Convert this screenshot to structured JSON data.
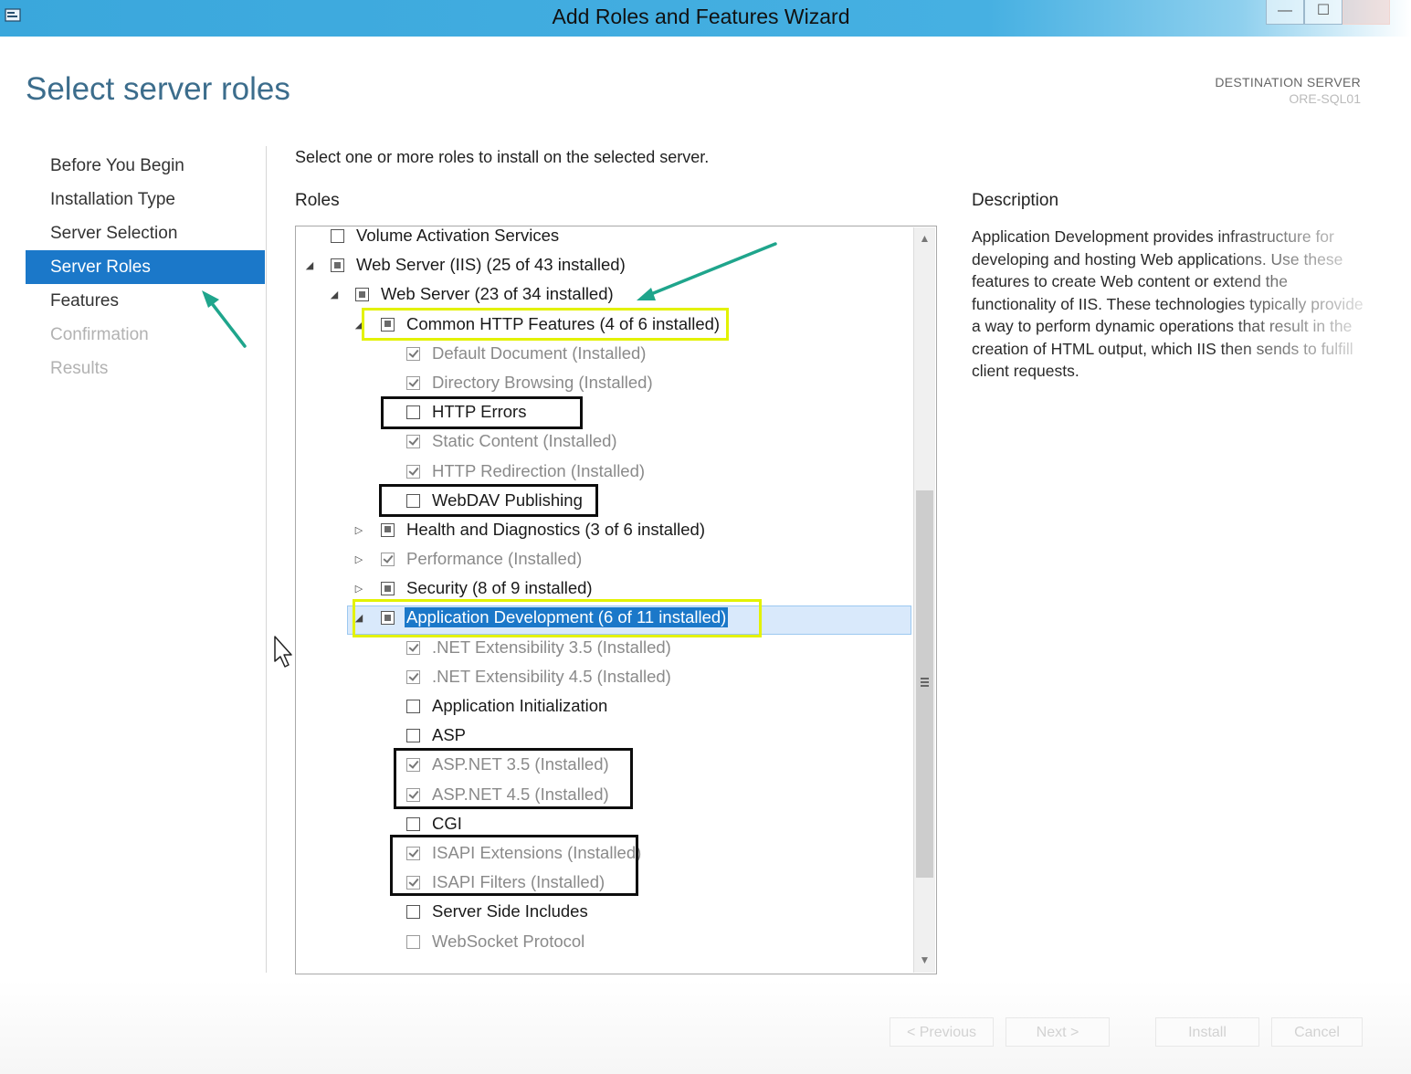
{
  "window": {
    "title": "Add Roles and Features Wizard",
    "minimize_glyph": "—",
    "maximize_glyph": "☐"
  },
  "page": {
    "title": "Select server roles",
    "destination_label": "DESTINATION SERVER",
    "destination_name": "ORE-SQL01"
  },
  "nav": {
    "items": [
      {
        "label": "Before You Begin",
        "state": "normal"
      },
      {
        "label": "Installation Type",
        "state": "normal"
      },
      {
        "label": "Server Selection",
        "state": "normal"
      },
      {
        "label": "Server Roles",
        "state": "active"
      },
      {
        "label": "Features",
        "state": "normal"
      },
      {
        "label": "Confirmation",
        "state": "disabled"
      },
      {
        "label": "Results",
        "state": "disabled"
      }
    ]
  },
  "main": {
    "instruction": "Select one or more roles to install on the selected server.",
    "roles_heading": "Roles",
    "description_heading": "Description",
    "description": "Application Development provides infrastructure for developing and hosting Web applications. Use these features to create Web content or extend the functionality of IIS. These technologies typically provide a way to perform dynamic operations that result in the creation of HTML output, which IIS then sends to fulfill client requests."
  },
  "tree": {
    "rows": [
      {
        "label": "Volume Activation Services",
        "level": 0,
        "expander": "",
        "check": "empty",
        "dim": false
      },
      {
        "label": "Web Server (IIS) (25 of 43 installed)",
        "level": 0,
        "expander": "expanded",
        "check": "partial",
        "dim": false
      },
      {
        "label": "Web Server (23 of 34 installed)",
        "level": 1,
        "expander": "expanded",
        "check": "partial",
        "dim": false
      },
      {
        "label": "Common HTTP Features (4 of 6 installed)",
        "level": 2,
        "expander": "expanded",
        "check": "partial",
        "dim": false
      },
      {
        "label": "Default Document (Installed)",
        "level": 3,
        "expander": "",
        "check": "checked",
        "dim": true
      },
      {
        "label": "Directory Browsing (Installed)",
        "level": 3,
        "expander": "",
        "check": "checked",
        "dim": true
      },
      {
        "label": "HTTP Errors",
        "level": 3,
        "expander": "",
        "check": "empty",
        "dim": false
      },
      {
        "label": "Static Content (Installed)",
        "level": 3,
        "expander": "",
        "check": "checked",
        "dim": true
      },
      {
        "label": "HTTP Redirection (Installed)",
        "level": 3,
        "expander": "",
        "check": "checked",
        "dim": true
      },
      {
        "label": "WebDAV Publishing",
        "level": 3,
        "expander": "",
        "check": "empty",
        "dim": false
      },
      {
        "label": "Health and Diagnostics (3 of 6 installed)",
        "level": 2,
        "expander": "collapsed",
        "check": "partial",
        "dim": false
      },
      {
        "label": "Performance (Installed)",
        "level": 2,
        "expander": "collapsed",
        "check": "checked",
        "dim": true
      },
      {
        "label": "Security (8 of 9 installed)",
        "level": 2,
        "expander": "collapsed",
        "check": "partial",
        "dim": false
      },
      {
        "label": "Application Development (6 of 11 installed)",
        "level": 2,
        "expander": "expanded",
        "check": "partial",
        "dim": false,
        "selected": true
      },
      {
        "label": ".NET Extensibility 3.5 (Installed)",
        "level": 3,
        "expander": "",
        "check": "checked",
        "dim": true
      },
      {
        "label": ".NET Extensibility 4.5 (Installed)",
        "level": 3,
        "expander": "",
        "check": "checked",
        "dim": true
      },
      {
        "label": "Application Initialization",
        "level": 3,
        "expander": "",
        "check": "empty",
        "dim": false
      },
      {
        "label": "ASP",
        "level": 3,
        "expander": "",
        "check": "empty",
        "dim": false
      },
      {
        "label": "ASP.NET 3.5 (Installed)",
        "level": 3,
        "expander": "",
        "check": "checked",
        "dim": true
      },
      {
        "label": "ASP.NET 4.5 (Installed)",
        "level": 3,
        "expander": "",
        "check": "checked",
        "dim": true
      },
      {
        "label": "CGI",
        "level": 3,
        "expander": "",
        "check": "empty",
        "dim": false
      },
      {
        "label": "ISAPI Extensions (Installed)",
        "level": 3,
        "expander": "",
        "check": "checked",
        "dim": true
      },
      {
        "label": "ISAPI Filters (Installed)",
        "level": 3,
        "expander": "",
        "check": "checked",
        "dim": true
      },
      {
        "label": "Server Side Includes",
        "level": 3,
        "expander": "",
        "check": "empty",
        "dim": false
      },
      {
        "label": "WebSocket Protocol",
        "level": 3,
        "expander": "",
        "check": "empty",
        "dim": true
      }
    ]
  },
  "footer": {
    "previous": "< Previous",
    "next": "Next >",
    "install": "Install",
    "cancel": "Cancel"
  },
  "colors": {
    "accent": "#1b78c9",
    "annotation_yellow": "#e3f200",
    "annotation_black": "#0d0d0d",
    "arrow": "#1fa58c"
  }
}
